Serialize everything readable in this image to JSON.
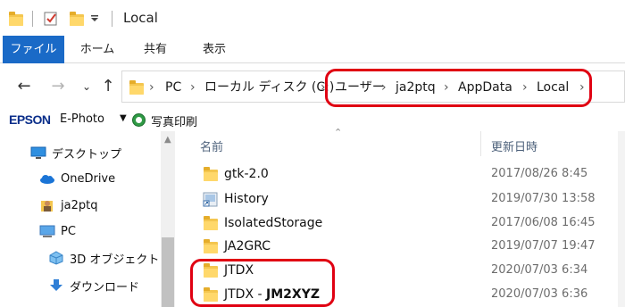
{
  "window": {
    "title": "Local"
  },
  "ribbon": {
    "tabs": [
      "ファイル",
      "ホーム",
      "共有",
      "表示"
    ]
  },
  "address": {
    "crumbs": [
      "PC",
      "ローカル ディスク (C:)",
      "ユーザー",
      "ja2ptq",
      "AppData",
      "Local"
    ]
  },
  "epson": {
    "logo": "EPSON",
    "app": "E-Photo",
    "print": "写真印刷"
  },
  "nav_pane": {
    "items": [
      {
        "label": "デスクトップ",
        "icon": "desktop-icon"
      },
      {
        "label": "OneDrive",
        "icon": "cloud-icon"
      },
      {
        "label": "ja2ptq",
        "icon": "user-icon"
      },
      {
        "label": "PC",
        "icon": "pc-icon"
      },
      {
        "label": "3D オブジェクト",
        "icon": "3d-objects-icon"
      },
      {
        "label": "ダウンロード",
        "icon": "download-icon"
      }
    ]
  },
  "file_list": {
    "columns": {
      "name": "名前",
      "modified": "更新日時"
    },
    "rows": [
      {
        "name": "gtk-2.0",
        "modified": "2017/08/26 8:45",
        "icon": "folder-icon"
      },
      {
        "name": "History",
        "modified": "2019/07/30 13:58",
        "icon": "shortcut-icon"
      },
      {
        "name": "IsolatedStorage",
        "modified": "2017/06/08 16:45",
        "icon": "folder-icon"
      },
      {
        "name": "JA2GRC",
        "modified": "2019/07/07 19:47",
        "icon": "folder-icon"
      },
      {
        "name": "JTDX",
        "modified": "2020/07/03 6:34",
        "icon": "folder-icon"
      },
      {
        "name_prefix": "JTDX - ",
        "name_suffix": "JM2XYZ",
        "modified": "2020/07/03 6:36",
        "icon": "folder-icon"
      }
    ]
  },
  "colors": {
    "accent": "#1a6ac7",
    "highlight": "#e00012",
    "folder": "#f4c64f"
  }
}
